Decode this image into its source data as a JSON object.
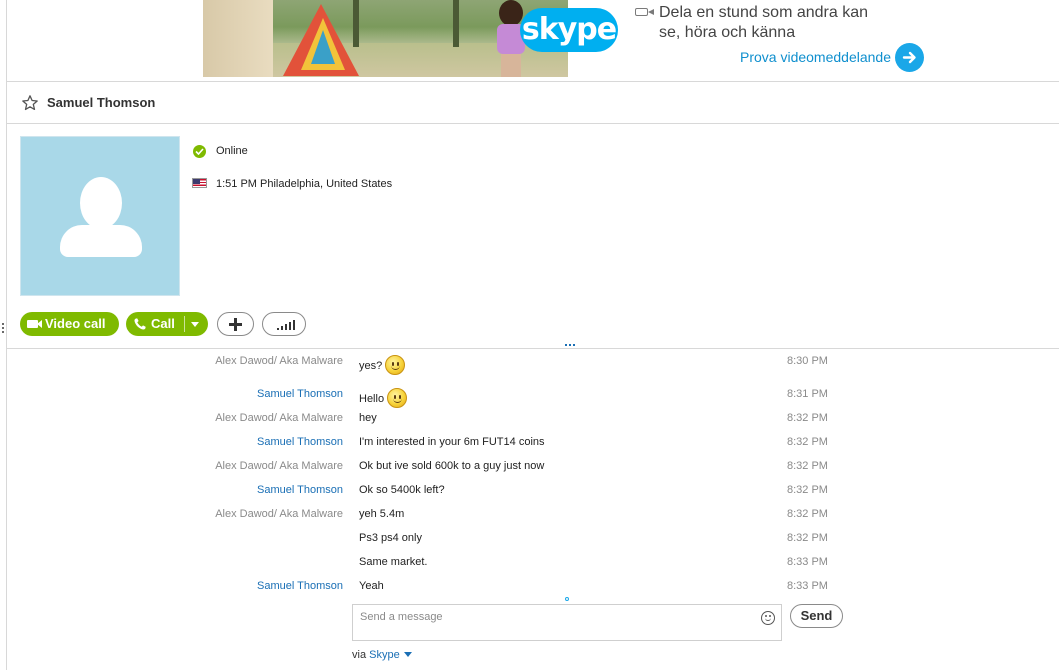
{
  "ad": {
    "logo_text": "skype",
    "headline": "Dela en stund som andra kan se, höra och känna",
    "link": "Prova videomeddelande"
  },
  "header": {
    "contact_name": "Samuel Thomson"
  },
  "profile": {
    "status": "Online",
    "location": "1:51 PM Philadelphia, United States"
  },
  "actions": {
    "video_call": "Video call",
    "call": "Call"
  },
  "messages": [
    {
      "sender": "Alex Dawod/ Aka Malware",
      "text": "yes?",
      "time": "8:30 PM",
      "emoticon": "smile"
    },
    {
      "sender": "Samuel Thomson",
      "text": "Hello",
      "time": "8:31 PM",
      "emoticon": "smile"
    },
    {
      "sender": "Alex Dawod/ Aka Malware",
      "text": "hey",
      "time": "8:32 PM"
    },
    {
      "sender": "Samuel Thomson",
      "text": "I'm interested in your 6m FUT14 coins",
      "time": "8:32 PM"
    },
    {
      "sender": "Alex Dawod/ Aka Malware",
      "text": "Ok but ive sold 600k to a guy just now",
      "time": "8:32 PM"
    },
    {
      "sender": "Samuel Thomson",
      "text": "Ok so 5400k left?",
      "time": "8:32 PM"
    },
    {
      "sender": "Alex Dawod/ Aka Malware",
      "text": "yeh 5.4m",
      "time": "8:32 PM"
    },
    {
      "sender": "",
      "text": "Ps3 ps4 only",
      "time": "8:32 PM"
    },
    {
      "sender": "",
      "text": "Same market.",
      "time": "8:33 PM"
    },
    {
      "sender": "Samuel Thomson",
      "text": "Yeah",
      "time": "8:33 PM"
    }
  ],
  "composer": {
    "placeholder": "Send a message",
    "value": "",
    "send_label": "Send",
    "via_label": "via",
    "via_service": "Skype"
  },
  "colors": {
    "accent_green": "#7fba00",
    "skype_blue": "#00aff0",
    "link_blue": "#1a6fb5",
    "muted_gray": "#8a8a8a"
  }
}
